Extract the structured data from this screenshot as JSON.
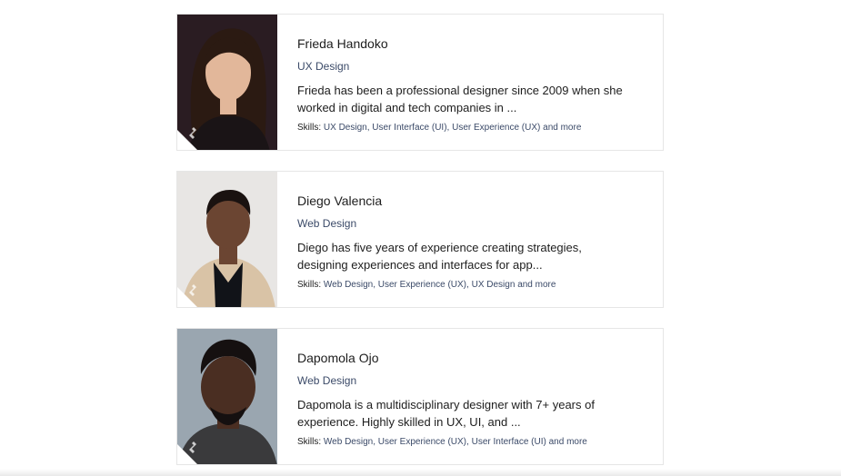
{
  "profiles": [
    {
      "name": "Frieda Handoko",
      "specialty": "UX Design",
      "bio": "Frieda has been a professional designer since 2009 when she worked in digital and tech companies in ...",
      "skills_label": "Skills:",
      "skills": [
        "UX Design",
        "User Interface (UI)",
        "User Experience (UX)"
      ],
      "more": "and more",
      "photo_bg": "#2a1c22",
      "skin": "#e2b79a",
      "hair": "#2b1a12",
      "clothing": "#1a1416"
    },
    {
      "name": "Diego Valencia",
      "specialty": "Web Design",
      "bio": "Diego has five years of experience creating strategies, designing experiences and interfaces for app...",
      "skills_label": "Skills:",
      "skills": [
        "Web Design",
        "User Experience (UX)",
        "UX Design"
      ],
      "more": "and more",
      "photo_bg": "#e8e6e4",
      "skin": "#6b4532",
      "hair": "#1a1210",
      "clothing": "#d9c3a6"
    },
    {
      "name": "Dapomola Ojo",
      "specialty": "Web Design",
      "bio": "Dapomola is a multidisciplinary designer with 7+ years of experience. Highly skilled in UX, UI, and ...",
      "skills_label": "Skills:",
      "skills": [
        "Web Design",
        "User Experience (UX)",
        "User Interface (UI)"
      ],
      "more": "and more",
      "photo_bg": "#9aa6b0",
      "skin": "#4a2e22",
      "hair": "#151010",
      "clothing": "#3a3a3c"
    }
  ]
}
